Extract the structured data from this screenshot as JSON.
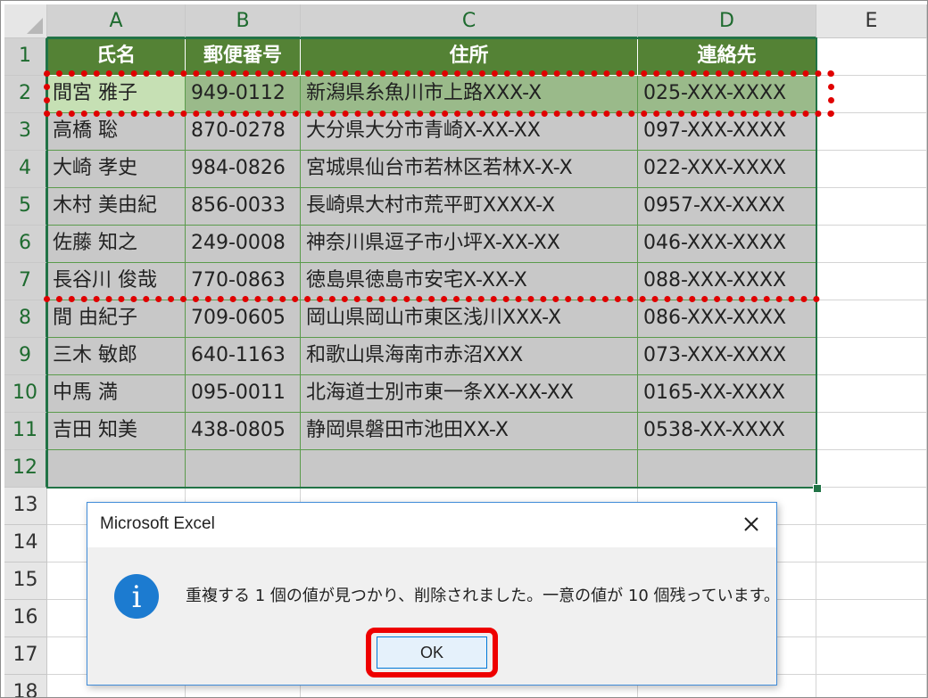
{
  "columns": [
    "A",
    "B",
    "C",
    "D",
    "E"
  ],
  "row_numbers": [
    "1",
    "2",
    "3",
    "4",
    "5",
    "6",
    "7",
    "8",
    "9",
    "10",
    "11",
    "12",
    "13",
    "14",
    "15",
    "16",
    "17",
    "18"
  ],
  "header": [
    "氏名",
    "郵便番号",
    "住所",
    "連絡先"
  ],
  "rows": [
    [
      "間宮 雅子",
      "949-0112",
      "新潟県糸魚川市上路XXX-X",
      "025-XXX-XXXX"
    ],
    [
      "高橋 聡",
      "870-0278",
      "大分県大分市青崎X-XX-XX",
      "097-XXX-XXXX"
    ],
    [
      "大崎 孝史",
      "984-0826",
      "宮城県仙台市若林区若林X-X-X",
      "022-XXX-XXXX"
    ],
    [
      "木村 美由紀",
      "856-0033",
      "長崎県大村市荒平町XXXX-X",
      "0957-XX-XXXX"
    ],
    [
      "佐藤 知之",
      "249-0008",
      "神奈川県逗子市小坪X-XX-XX",
      "046-XXX-XXXX"
    ],
    [
      "長谷川 俊哉",
      "770-0863",
      "徳島県徳島市安宅X-XX-X",
      "088-XXX-XXXX"
    ],
    [
      "間 由紀子",
      "709-0605",
      "岡山県岡山市東区浅川XXX-X",
      "086-XXX-XXXX"
    ],
    [
      "三木 敏郎",
      "640-1163",
      "和歌山県海南市赤沼XXX",
      "073-XXX-XXXX"
    ],
    [
      "中馬 満",
      "095-0011",
      "北海道士別市東一条XX-XX-XX",
      "0165-XX-XXXX"
    ],
    [
      "吉田 知美",
      "438-0805",
      "静岡県磐田市池田XX-X",
      "0538-XX-XXXX"
    ],
    [
      "",
      "",
      "",
      ""
    ]
  ],
  "dialog": {
    "title": "Microsoft Excel",
    "message": "重複する 1 個の値が見つかり、削除されました。一意の値が 10 個残っています。",
    "ok_label": "OK",
    "icon": "info-icon",
    "close_icon": "close-icon"
  },
  "colors": {
    "header_fill": "#548235",
    "selection_border": "#217346",
    "annotation_red": "#e00000",
    "dialog_icon": "#1c7bd0"
  }
}
